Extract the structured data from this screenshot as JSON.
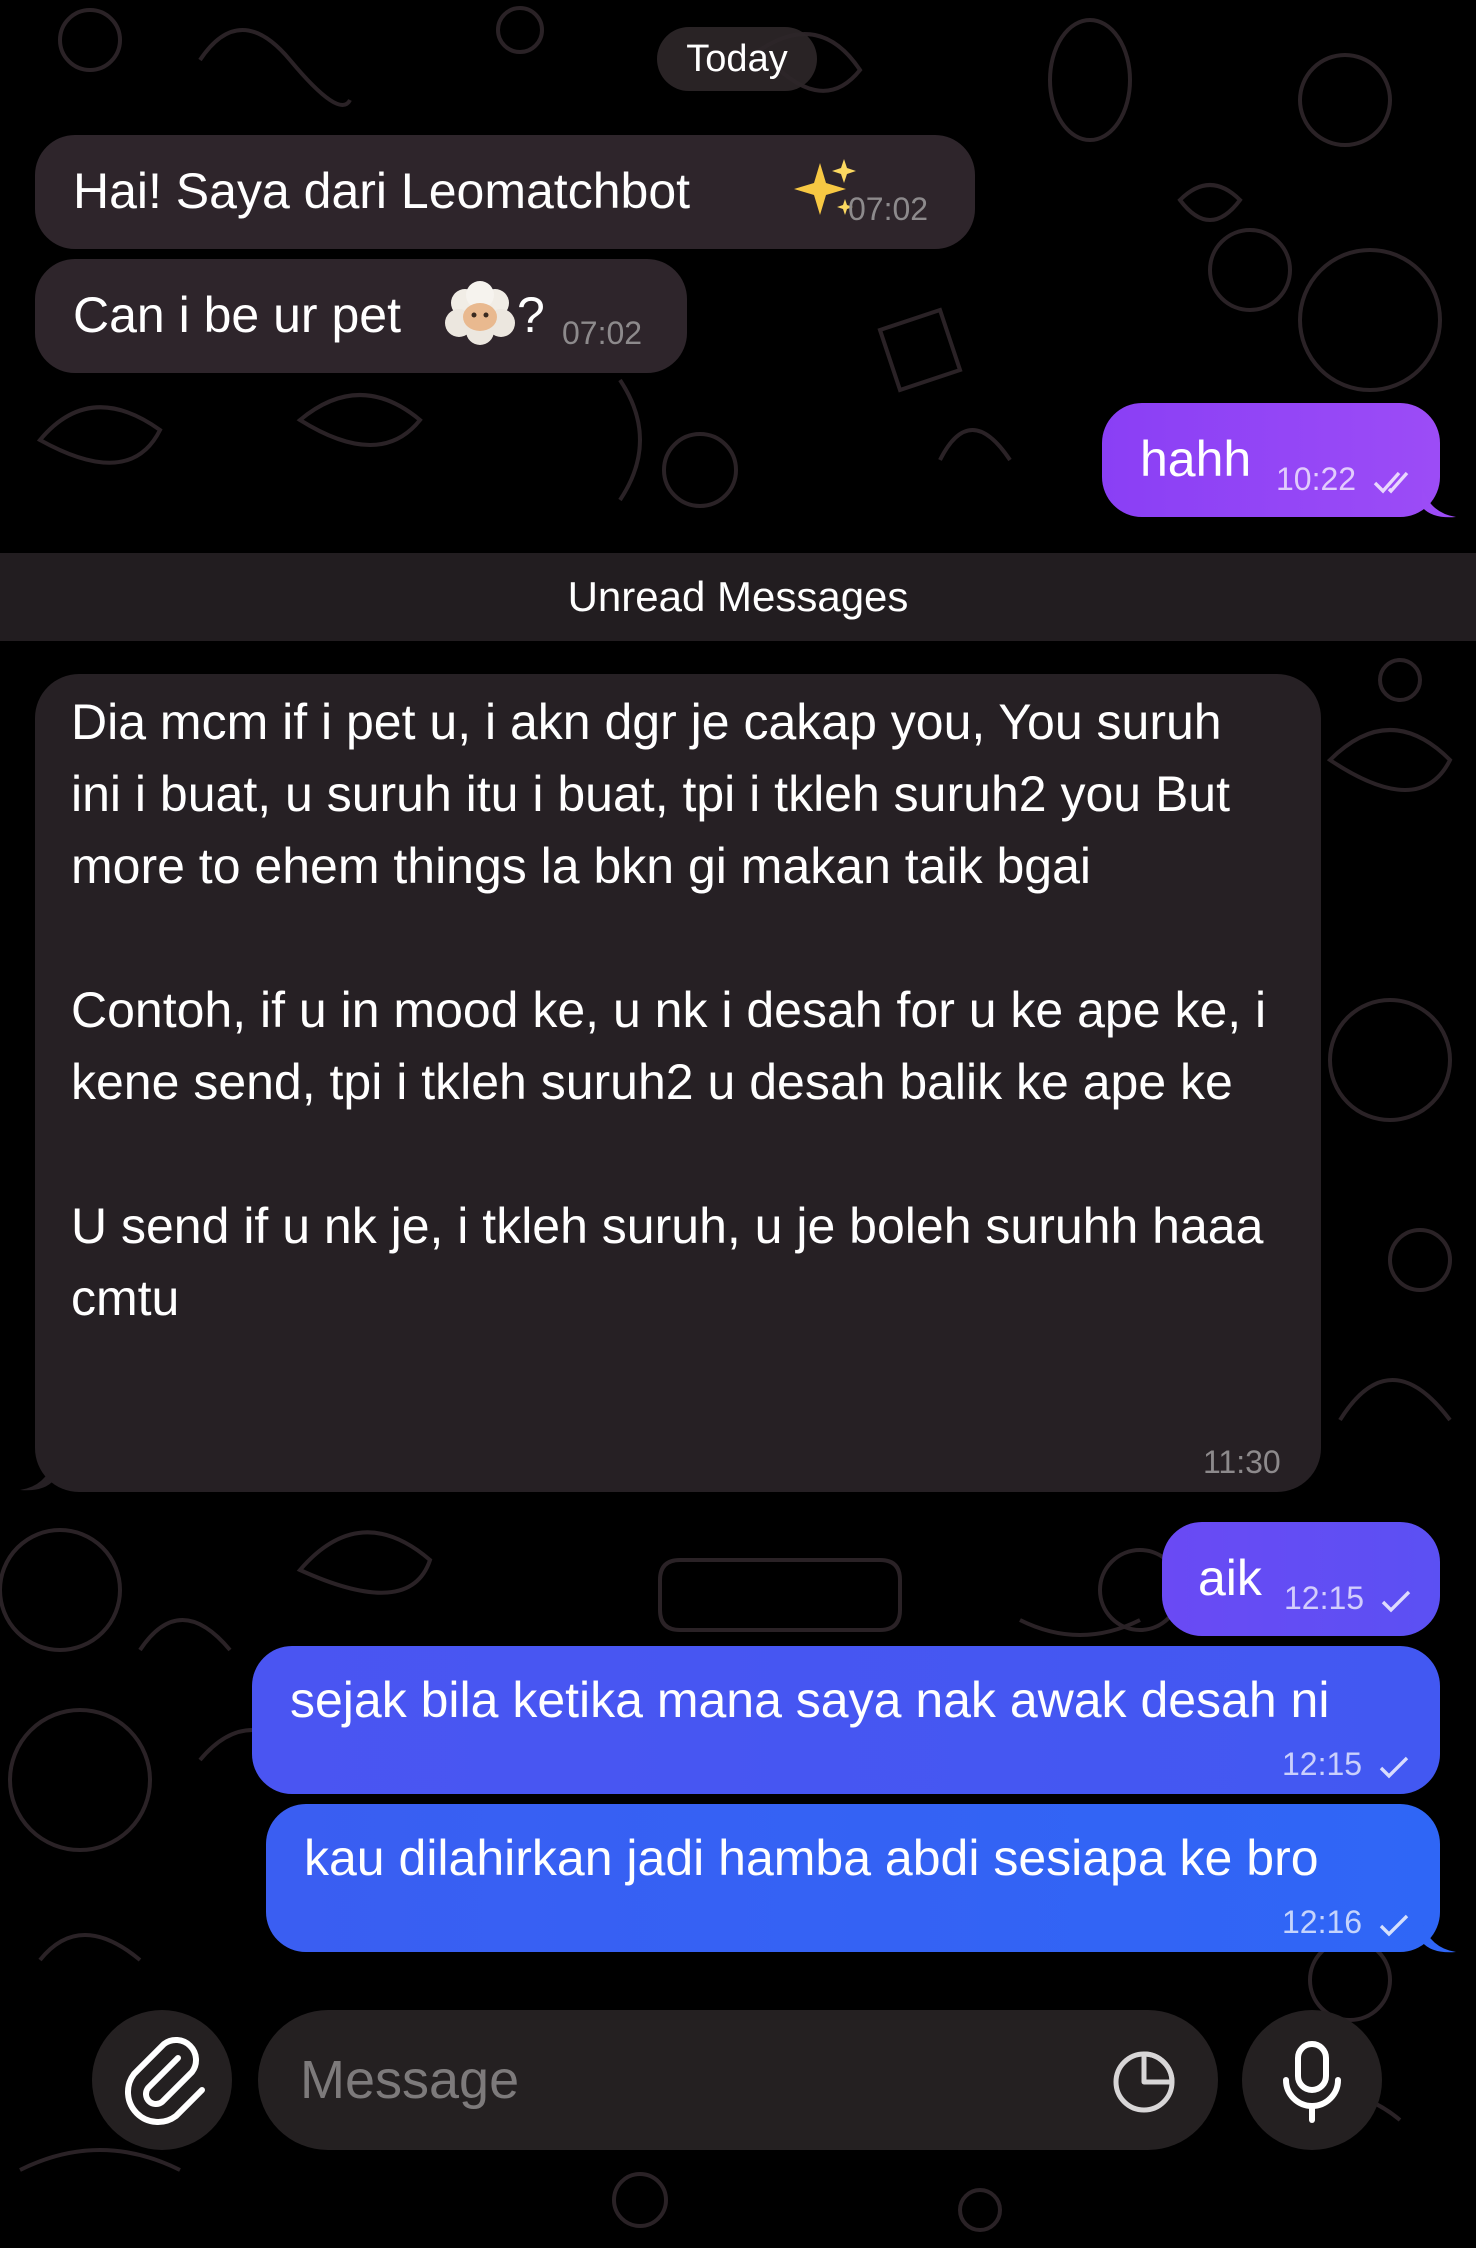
{
  "date_separator": "Today",
  "messages_top": [
    {
      "side": "in",
      "text": "Hai! Saya dari Leomatchbot",
      "emoji": "sparkles",
      "time": "07:02"
    },
    {
      "side": "in",
      "text_before": "Can i be ur pet",
      "emoji": "sheep-face",
      "text_after": "?",
      "time": "07:02"
    },
    {
      "side": "out",
      "text": "hahh",
      "time": "10:22",
      "status": "read"
    }
  ],
  "unread_label": "Unread Messages",
  "long_message": {
    "side": "in",
    "paragraphs": [
      "Dia mcm if i pet u, i akn dgr je cakap you, You suruh ini i buat, u suruh itu i buat, tpi i tkleh suruh2 you But more to ehem things la bkn gi makan taik bgai",
      "Contoh, if u in mood ke, u nk i desah for u ke ape ke, i kene send, tpi i tkleh suruh2 u desah balik ke ape ke",
      "U send if u nk je, i tkleh suruh, u je boleh suruhh haaa cmtu"
    ],
    "time": "11:30"
  },
  "messages_bottom": [
    {
      "side": "out",
      "text": "aik",
      "time": "12:15",
      "status": "sent"
    },
    {
      "side": "out",
      "text": "sejak bila ketika mana saya nak awak desah ni",
      "time": "12:15",
      "status": "sent"
    },
    {
      "side": "out",
      "text": "kau dilahirkan jadi hamba abdi sesiapa ke bro",
      "time": "12:16",
      "status": "sent"
    }
  ],
  "composer": {
    "placeholder": "Message",
    "attach_icon": "paperclip-icon",
    "sticker_icon": "sticker-icon",
    "mic_icon": "microphone-icon"
  },
  "colors": {
    "incoming_bubble": "#2e252b",
    "outgoing_purple": "#8a3ff5",
    "outgoing_blue": "#3d5bf0",
    "background": "#000000",
    "unread_bar": "#221d20"
  }
}
